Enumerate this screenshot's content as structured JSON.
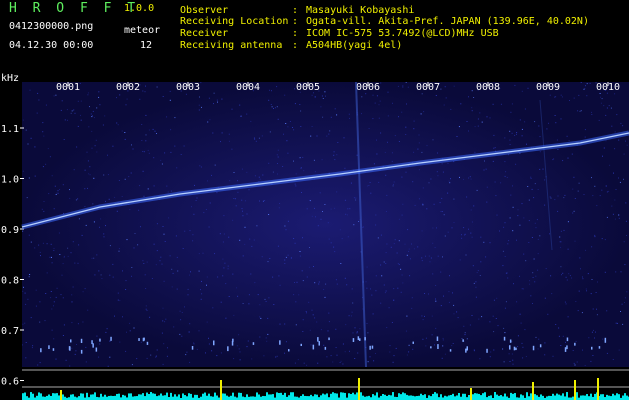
{
  "app": {
    "name": "H R O F F T",
    "version": "1.0.0"
  },
  "file": {
    "name": "0412300000.png",
    "datetime": "04.12.30 00:00"
  },
  "meteor": {
    "label": "meteor",
    "count": "12"
  },
  "info": [
    {
      "key": "Observer",
      "value": "Masayuki Kobayashi"
    },
    {
      "key": "Receiving Location",
      "value": "Ogata-vill. Akita-Pref. JAPAN (139.96E, 40.02N)"
    },
    {
      "key": "Receiver",
      "value": "ICOM IC-575 53.7492(@LCD)MHz USB"
    },
    {
      "key": "Receiving antenna",
      "value": "A504HB(yagi 4el)"
    }
  ],
  "spectrogram": {
    "y_unit": "kHz",
    "y_ticks": [
      "1.1",
      "1.0",
      "0.9",
      "0.8",
      "0.7",
      "0.6"
    ],
    "x_ticks": [
      "0001",
      "0002",
      "0003",
      "0004",
      "0005",
      "0006",
      "0007",
      "0008",
      "0009",
      "0010"
    ]
  },
  "colors": {
    "header_yellow": "#f0f000",
    "title_green": "#5ff05f",
    "spectrum_bg": "#0a0a3a",
    "trace": "#6ca8ff",
    "level_cyan": "#00e8e8"
  }
}
